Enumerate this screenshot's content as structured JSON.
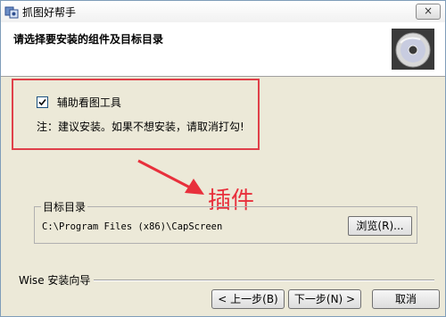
{
  "window": {
    "title": "抓图好帮手",
    "close_label": "×"
  },
  "header": {
    "title": "请选择要安装的组件及目标目录",
    "image_icon": "cd-disc-icon"
  },
  "components": {
    "option_label": "辅助看图工具",
    "option_checked": true,
    "note": "注：建议安装。如果不想安装，请取消打勾!"
  },
  "annotation": {
    "text": "插件",
    "color": "#e8303c"
  },
  "destination": {
    "legend": "目标目录",
    "path": "C:\\Program Files (x86)\\CapScreen",
    "browse_label": "浏览(R)..."
  },
  "footer": {
    "wizard_label": "Wise 安装向导",
    "back_label": "< 上一步(B)",
    "next_label": "下一步(N) >",
    "cancel_label": "取消"
  }
}
